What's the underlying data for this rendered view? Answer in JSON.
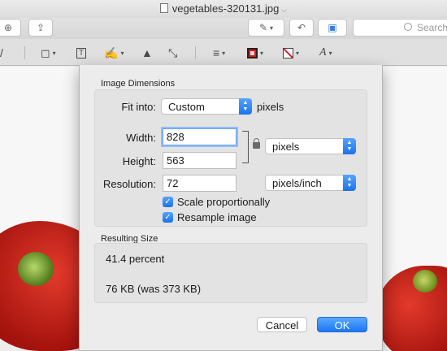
{
  "window": {
    "title": "vegetables-320131.jpg",
    "search_placeholder": "Search"
  },
  "icons": {
    "zoom": "zoom-icon",
    "share": "share-icon",
    "markup": "pen-icon",
    "rotate": "rotate-icon",
    "toolbox": "toolbox-icon",
    "search": "search-icon"
  },
  "dialog": {
    "dimensions_header": "Image Dimensions",
    "fit_into_label": "Fit into:",
    "fit_into_value": "Custom",
    "fit_into_unit": "pixels",
    "width_label": "Width:",
    "width_value": "828",
    "height_label": "Height:",
    "height_value": "563",
    "size_unit": "pixels",
    "resolution_label": "Resolution:",
    "resolution_value": "72",
    "resolution_unit": "pixels/inch",
    "scale_label": "Scale proportionally",
    "scale_checked": true,
    "resample_label": "Resample image",
    "resample_checked": true,
    "resulting_header": "Resulting Size",
    "result_percent": "41.4 percent",
    "result_size": "76 KB (was 373 KB)",
    "cancel_label": "Cancel",
    "ok_label": "OK"
  },
  "colors": {
    "accent": "#1b72f0",
    "focus_ring": "#93bff5"
  }
}
